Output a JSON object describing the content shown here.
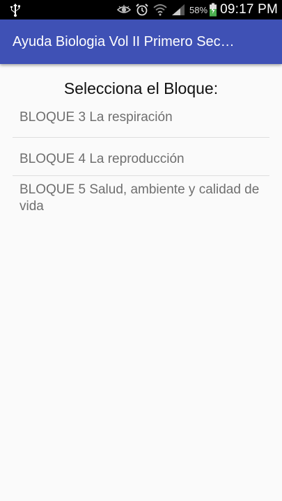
{
  "status_bar": {
    "battery_percent": "58%",
    "time": "09:17 PM",
    "icons": [
      "usb-icon",
      "eye-icon",
      "alarm-icon",
      "wifi-icon",
      "signal-icon",
      "battery-charging-icon"
    ]
  },
  "app_bar": {
    "title": "Ayuda Biologia Vol II Primero Sec…",
    "color": "#3f51b5"
  },
  "main": {
    "heading": "Selecciona el Bloque:",
    "items": [
      {
        "label": "BLOQUE 3 La respiración"
      },
      {
        "label": "BLOQUE 4 La reproducción"
      },
      {
        "label": "BLOQUE 5 Salud, ambiente y calidad de vida"
      }
    ]
  }
}
